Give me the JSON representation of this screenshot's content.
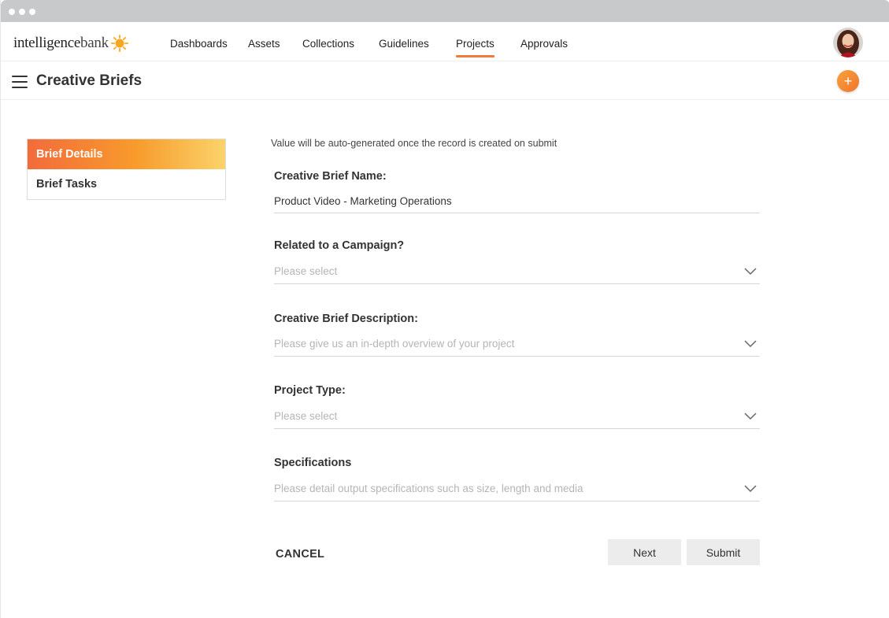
{
  "brand": {
    "logo_text_main": "intelligence",
    "logo_text_bank": "bank",
    "accent": "#f47a3a",
    "accent_light": "#fbd36a"
  },
  "topnav": {
    "items": [
      {
        "label": "Dashboards",
        "active": false
      },
      {
        "label": "Assets",
        "active": false
      },
      {
        "label": "Collections",
        "active": false
      },
      {
        "label": "Guidelines",
        "active": false
      },
      {
        "label": "Projects",
        "active": true
      },
      {
        "label": "Approvals",
        "active": false
      }
    ]
  },
  "header": {
    "title": "Creative Briefs",
    "menu_icon": "hamburger-icon",
    "add_icon": "plus-icon",
    "add_label": "+"
  },
  "sidebar": {
    "items": [
      {
        "label": "Brief Details",
        "active": true
      },
      {
        "label": "Brief Tasks",
        "active": false
      }
    ]
  },
  "form": {
    "hint": "Value will be auto-generated once the record is created on submit",
    "fields": [
      {
        "label": "Creative Brief Name:",
        "value": "Product Video - Marketing Operations",
        "placeholder": ""
      },
      {
        "label": "Related to a Campaign?",
        "value": "",
        "placeholder": "Please select"
      },
      {
        "label": "Creative Brief Description:",
        "value": "",
        "placeholder": "Please give us an in-depth overview of your project"
      },
      {
        "label": "Project Type:",
        "value": "",
        "placeholder": "Please select"
      },
      {
        "label": "Specifications",
        "value": "",
        "placeholder": "Please detail output specifications such as size, length and media"
      }
    ],
    "cancel_label": "CANCEL",
    "next_label": "Next",
    "submit_label": "Submit"
  }
}
